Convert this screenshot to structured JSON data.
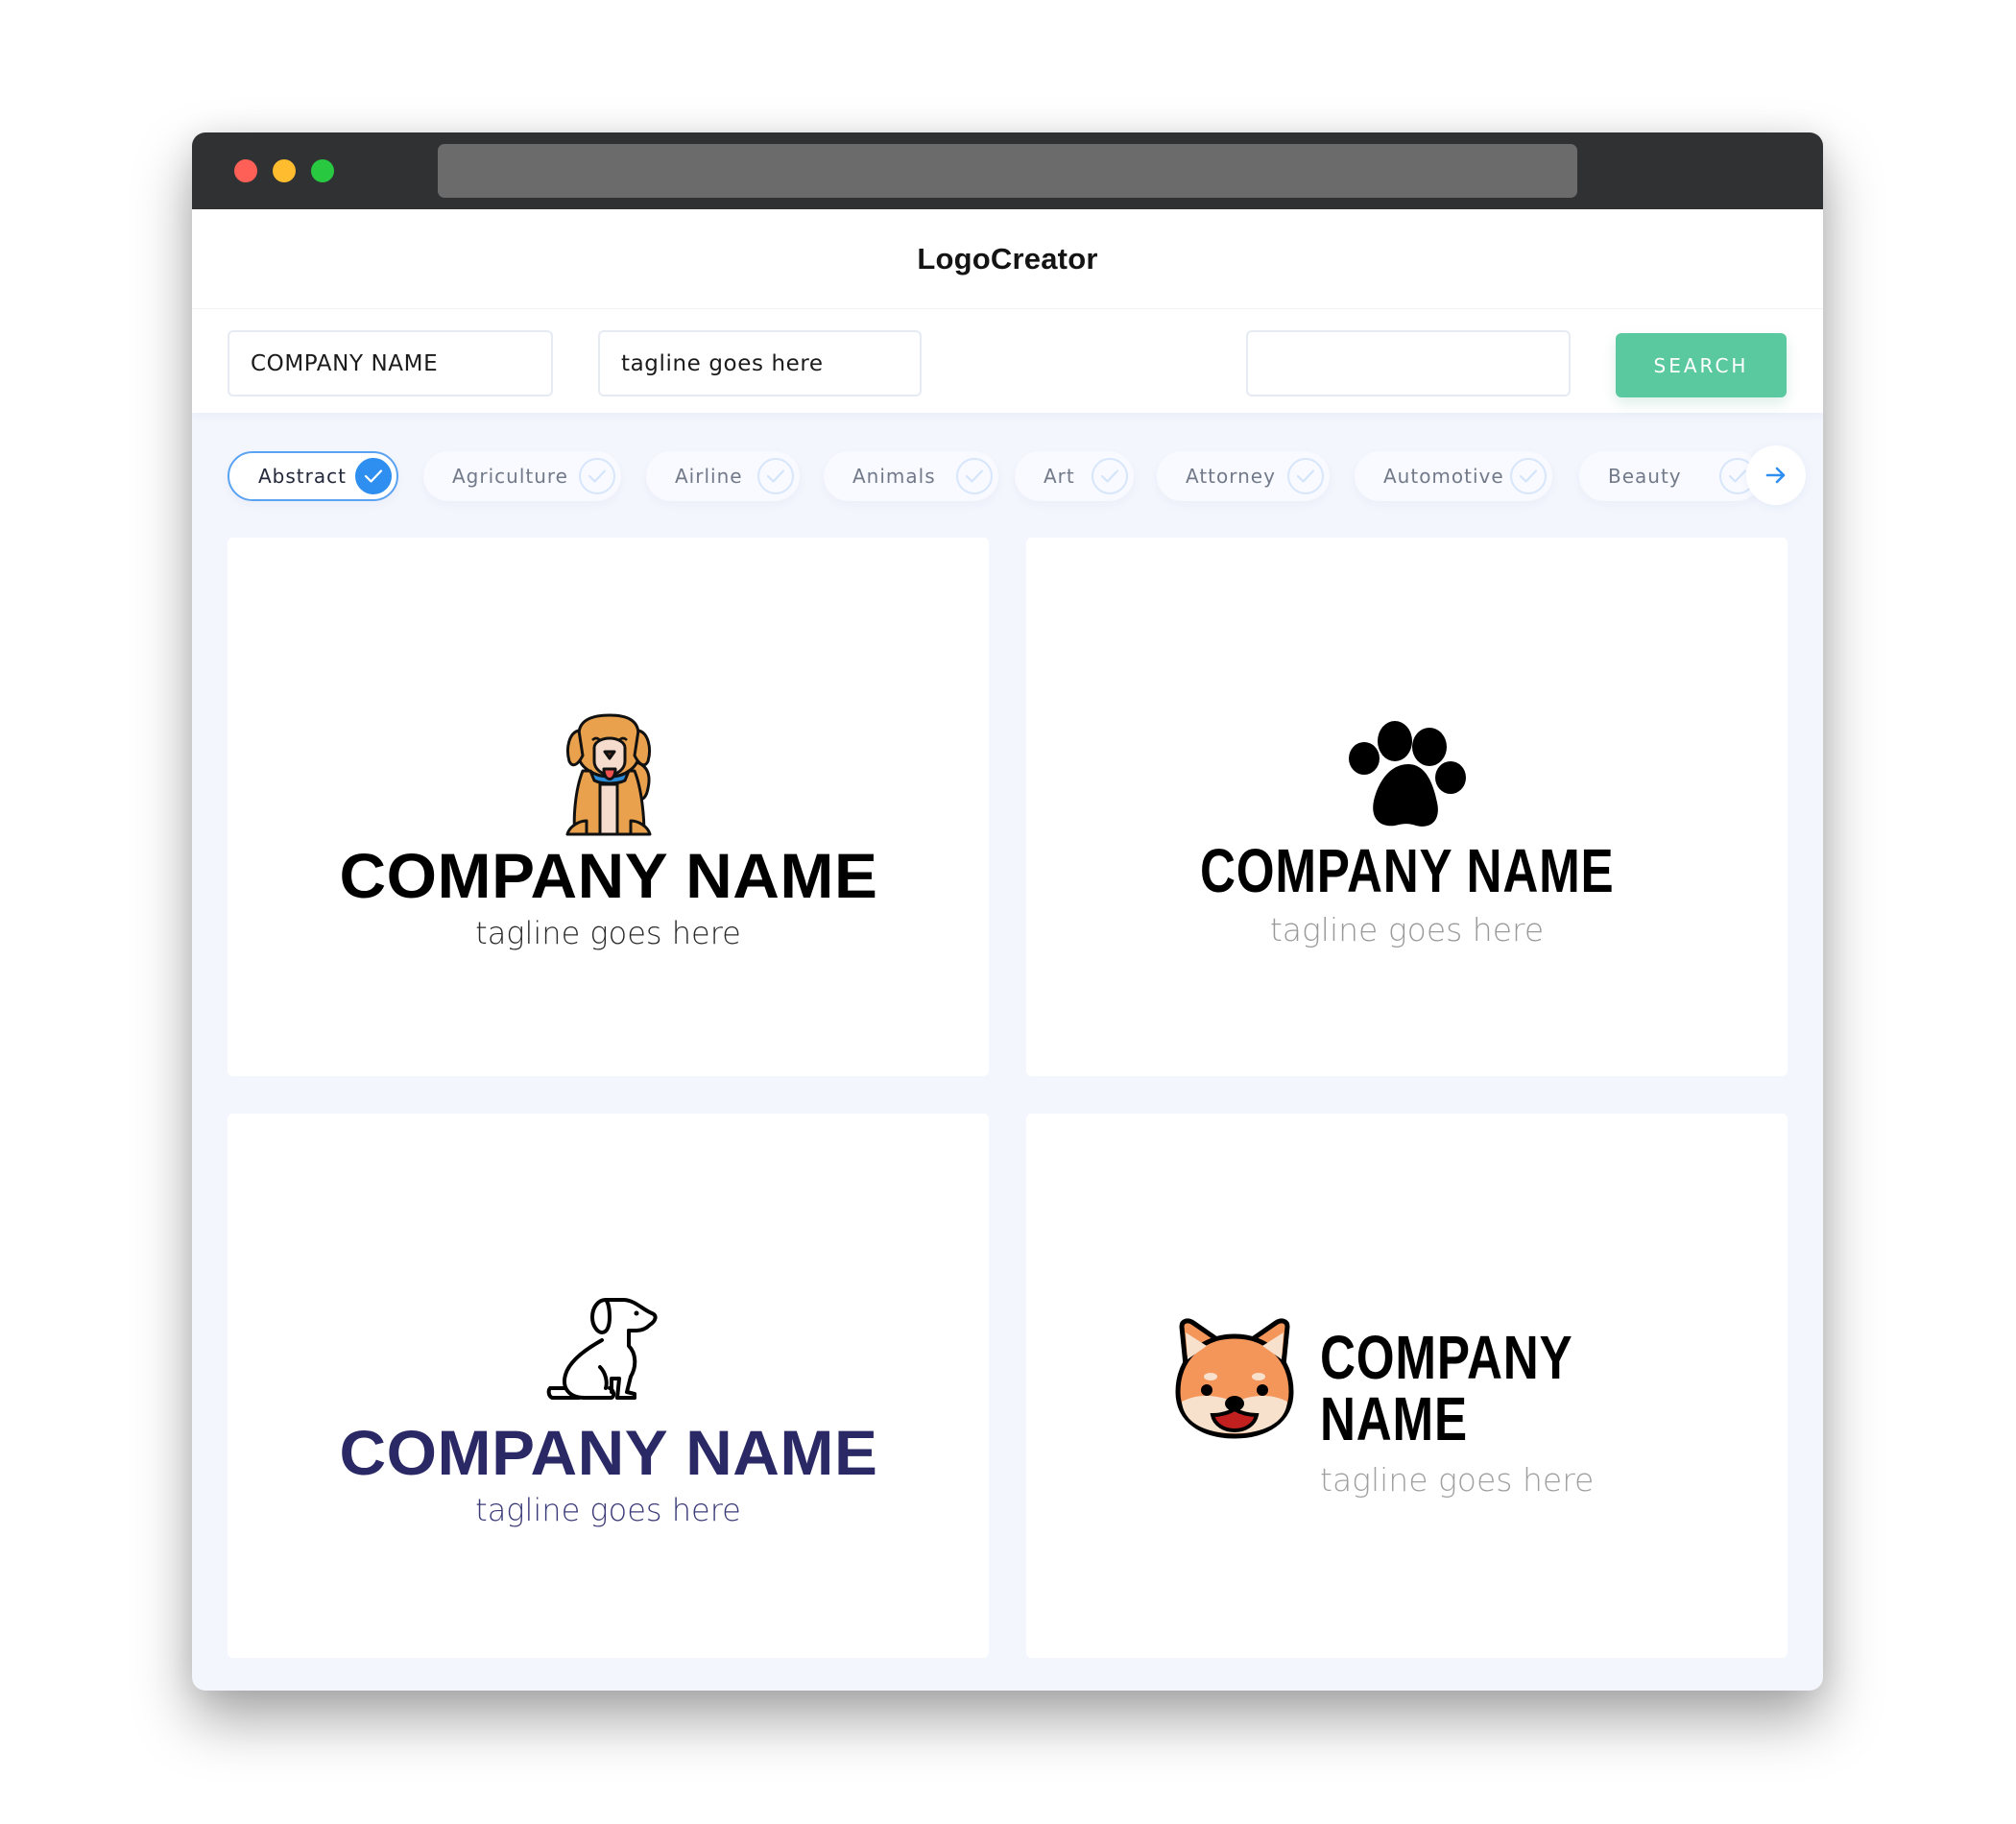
{
  "window": {
    "controls": [
      "close",
      "minimize",
      "maximize"
    ],
    "address_bar": ""
  },
  "header": {
    "title": "LogoCreator"
  },
  "search": {
    "company_value": "COMPANY NAME",
    "tagline_value": "tagline goes here",
    "keyword_value": "",
    "button_label": "SEARCH",
    "button_color": "#5bc9a0"
  },
  "categories": {
    "items": [
      {
        "label": "Abstract",
        "selected": true
      },
      {
        "label": "Agriculture",
        "selected": false
      },
      {
        "label": "Airline",
        "selected": false
      },
      {
        "label": "Animals",
        "selected": false
      },
      {
        "label": "Art",
        "selected": false
      },
      {
        "label": "Attorney",
        "selected": false
      },
      {
        "label": "Automotive",
        "selected": false
      },
      {
        "label": "Beauty",
        "selected": false
      }
    ],
    "next_icon": "arrow-right-icon",
    "accent": "#2e8ff0"
  },
  "logos": [
    {
      "icon": "golden-dog-sitting-icon",
      "company": "COMPANY NAME",
      "tagline": "tagline goes here",
      "name_color": "#000000",
      "tagline_color": "#2a2a2a"
    },
    {
      "icon": "paw-print-icon",
      "company": "COMPANY NAME",
      "tagline": "tagline goes here",
      "name_color": "#000000",
      "tagline_color": "#9a9a9a"
    },
    {
      "icon": "dog-outline-icon",
      "company": "COMPANY NAME",
      "tagline": "tagline goes here",
      "name_color": "#2a2965",
      "tagline_color": "#3b3a78"
    },
    {
      "icon": "shiba-face-icon",
      "company": "COMPANY NAME",
      "tagline": "tagline goes here",
      "name_color": "#000000",
      "tagline_color": "#a0a0a0"
    }
  ]
}
